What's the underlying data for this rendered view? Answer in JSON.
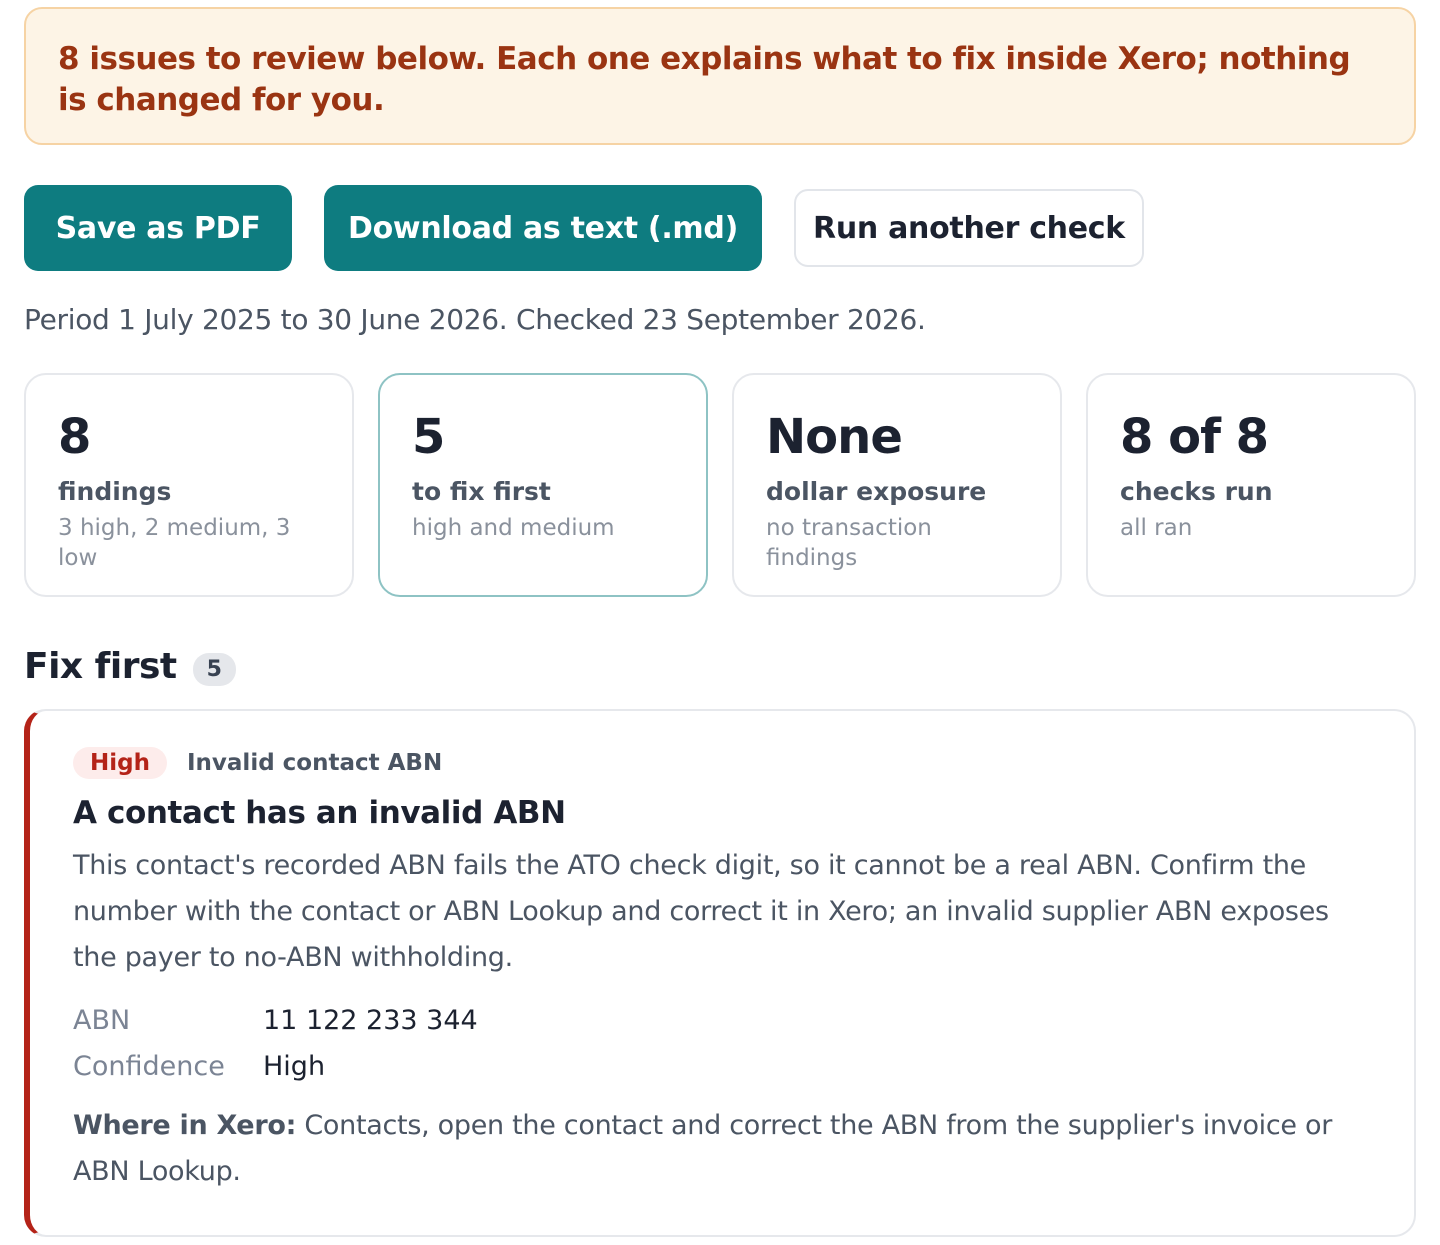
{
  "alert": {
    "text": "8 issues to review below. Each one explains what to fix inside Xero; nothing is changed for you."
  },
  "actions": {
    "save_pdf": "Save as PDF",
    "download_md": "Download as text (.md)",
    "run_again": "Run another check"
  },
  "period_text": "Period 1 July 2025 to 30 June 2026. Checked 23 September 2026.",
  "stats": [
    {
      "value": "8",
      "label": "findings",
      "sub": "3 high, 2 medium, 3 low"
    },
    {
      "value": "5",
      "label": "to fix first",
      "sub": "high and medium"
    },
    {
      "value": "None",
      "label": "dollar exposure",
      "sub": "no transaction findings"
    },
    {
      "value": "8 of 8",
      "label": "checks run",
      "sub": "all ran"
    }
  ],
  "section": {
    "title": "Fix first",
    "count": "5"
  },
  "finding": {
    "severity": "High",
    "check": "Invalid contact ABN",
    "title": "A contact has an invalid ABN",
    "body": "This contact's recorded ABN fails the ATO check digit, so it cannot be a real ABN. Confirm the number with the contact or ABN Lookup and correct it in Xero; an invalid supplier ABN exposes the payer to no-ABN withholding.",
    "meta": [
      {
        "key": "ABN",
        "value": "11 122 233 344"
      },
      {
        "key": "Confidence",
        "value": "High"
      }
    ],
    "where_label": "Where in Xero:",
    "where_text": " Contacts, open the contact and correct the ABN from the supplier's invoice or ABN Lookup."
  },
  "colors": {
    "primary": "#0e7c80",
    "alert_bg": "#fdf4e6",
    "alert_text": "#9a3412",
    "severity_high": "#b42318"
  }
}
